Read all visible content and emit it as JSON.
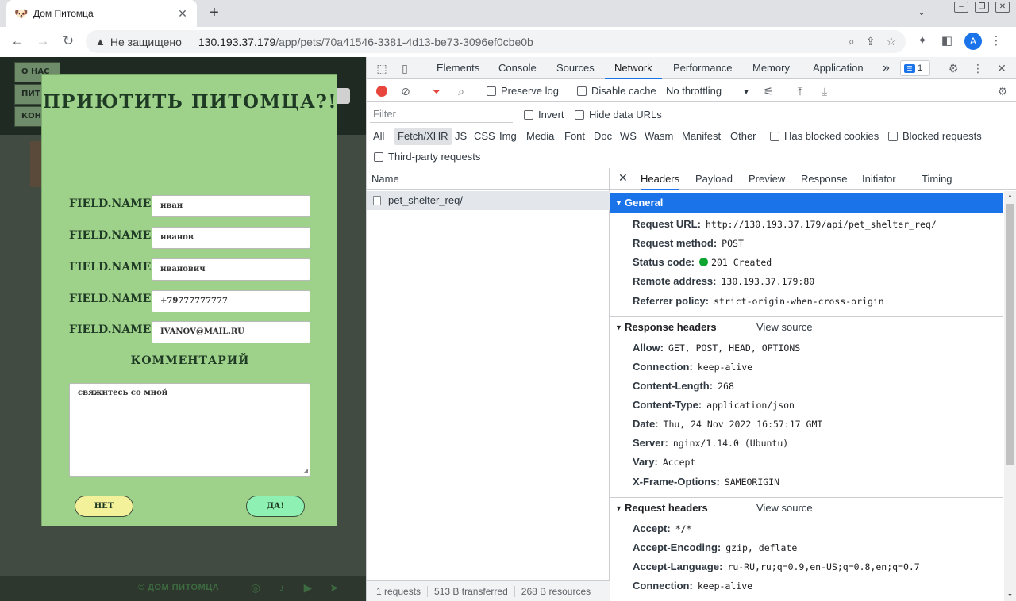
{
  "browser": {
    "tab_title": "Дом Питомца",
    "tab_close": "✕",
    "new_tab": "+",
    "insecure_label": "Не защищено",
    "url_host": "130.193.37.179",
    "url_path": "/app/pets/70a41546-3381-4d13-be73-3096ef0cbe0b",
    "avatar_letter": "A"
  },
  "page": {
    "nav": [
      "О НАС",
      "ПИТ",
      "КОН"
    ],
    "footer_copy": "© ДОМ ПИТОМЦА",
    "modal": {
      "title": "ПРИЮТИТЬ ПИТОМЦА?!",
      "field_label": "FIELD.NAME",
      "fields": [
        "иван",
        "иванов",
        "иванович",
        "+79777777777",
        "IVANOV@MAIL.RU"
      ],
      "comment_label": "КОММЕНТАРИЙ",
      "comment_value": "свяжитесь со мной",
      "no_button": "НЕТ",
      "yes_button": "ДА!"
    }
  },
  "devtools": {
    "tabs": [
      "Elements",
      "Console",
      "Sources",
      "Network",
      "Performance",
      "Memory",
      "Application"
    ],
    "active_tab": "Network",
    "more": "»",
    "issues_count": "1",
    "toolbar": {
      "preserve_log": "Preserve log",
      "disable_cache": "Disable cache",
      "throttling": "No throttling"
    },
    "filter": {
      "placeholder": "Filter",
      "invert": "Invert",
      "hide_data_urls": "Hide data URLs",
      "types": [
        "All",
        "Fetch/XHR",
        "JS",
        "CSS",
        "Img",
        "Media",
        "Font",
        "Doc",
        "WS",
        "Wasm",
        "Manifest",
        "Other"
      ],
      "active_type": "Fetch/XHR",
      "has_blocked_cookies": "Has blocked cookies",
      "blocked_requests": "Blocked requests",
      "third_party": "Third-party requests"
    },
    "requests": {
      "header": "Name",
      "rows": [
        "pet_shelter_req/"
      ],
      "status": [
        "1 requests",
        "513 B transferred",
        "268 B resources"
      ]
    },
    "details": {
      "close": "✕",
      "tabs": [
        "Headers",
        "Payload",
        "Preview",
        "Response",
        "Initiator",
        "Timing"
      ],
      "active_tab": "Headers",
      "general_title": "General",
      "general": [
        {
          "k": "Request URL:",
          "v": "http://130.193.37.179/api/pet_shelter_req/"
        },
        {
          "k": "Request method:",
          "v": "POST"
        },
        {
          "k": "Status code:",
          "v": "201 Created"
        },
        {
          "k": "Remote address:",
          "v": "130.193.37.179:80"
        },
        {
          "k": "Referrer policy:",
          "v": "strict-origin-when-cross-origin"
        }
      ],
      "response_title": "Response headers",
      "view_source": "View source",
      "response": [
        {
          "k": "Allow:",
          "v": "GET, POST, HEAD, OPTIONS"
        },
        {
          "k": "Connection:",
          "v": "keep-alive"
        },
        {
          "k": "Content-Length:",
          "v": "268"
        },
        {
          "k": "Content-Type:",
          "v": "application/json"
        },
        {
          "k": "Date:",
          "v": "Thu, 24 Nov 2022 16:57:17 GMT"
        },
        {
          "k": "Server:",
          "v": "nginx/1.14.0 (Ubuntu)"
        },
        {
          "k": "Vary:",
          "v": "Accept"
        },
        {
          "k": "X-Frame-Options:",
          "v": "SAMEORIGIN"
        }
      ],
      "request_title": "Request headers",
      "request": [
        {
          "k": "Accept:",
          "v": "*/*"
        },
        {
          "k": "Accept-Encoding:",
          "v": "gzip, deflate"
        },
        {
          "k": "Accept-Language:",
          "v": "ru-RU,ru;q=0.9,en-US;q=0.8,en;q=0.7"
        },
        {
          "k": "Connection:",
          "v": "keep-alive"
        }
      ]
    }
  }
}
